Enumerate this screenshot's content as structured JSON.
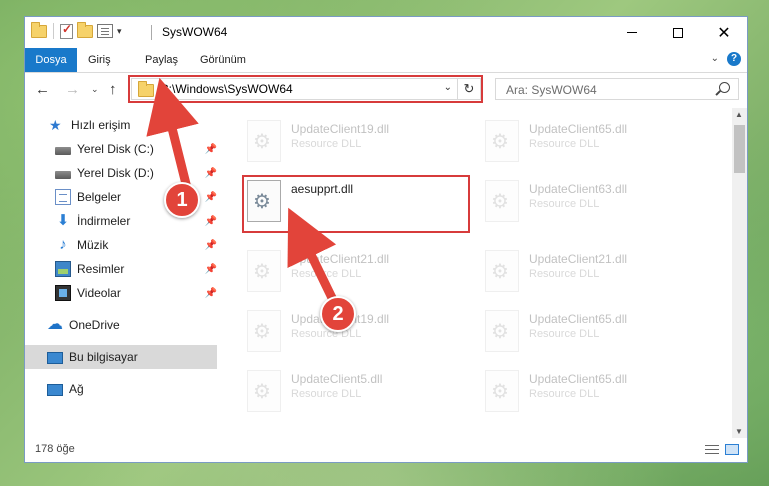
{
  "window": {
    "title": "SysWOW64",
    "controls": {
      "minimize_icon": "minimize-icon",
      "maximize_icon": "maximize-icon",
      "close_icon": "close-icon"
    }
  },
  "ribbon": {
    "tabs": [
      "Dosya",
      "Giriş",
      "Paylaş",
      "Görünüm"
    ],
    "accent": "#1979ca"
  },
  "address": {
    "path": "C:\\Windows\\SysWOW64"
  },
  "search": {
    "placeholder": "Ara: SysWOW64"
  },
  "sidebar": {
    "quick_access": "Hızlı erişim",
    "items": [
      {
        "label": "Yerel Disk (C:)",
        "pinned": true
      },
      {
        "label": "Yerel Disk (D:)",
        "pinned": true
      },
      {
        "label": "Belgeler",
        "pinned": true
      },
      {
        "label": "İndirmeler",
        "pinned": true
      },
      {
        "label": "Müzik",
        "pinned": true
      },
      {
        "label": "Resimler",
        "pinned": true
      },
      {
        "label": "Videolar",
        "pinned": true
      }
    ],
    "onedrive": "OneDrive",
    "this_pc": "Bu bilgisayar",
    "network": "Ağ"
  },
  "files": [
    {
      "name": "UpdateClient19.dll",
      "type": "Resource DLL"
    },
    {
      "name": "UpdateClient65.dll",
      "type": "Resource DLL"
    },
    {
      "name": "aesupprt.dll",
      "type": ""
    },
    {
      "name": "UpdateClient63.dll",
      "type": "Resource DLL"
    },
    {
      "name": "UpdateClient21.dll",
      "type": "Resource DLL"
    },
    {
      "name": "UpdateClient21.dll",
      "type": "Resource DLL"
    },
    {
      "name": "UpdateClient19.dll",
      "type": "Resource DLL"
    },
    {
      "name": "UpdateClient65.dll",
      "type": "Resource DLL"
    },
    {
      "name": "UpdateClient5.dll",
      "type": "Resource DLL"
    },
    {
      "name": "UpdateClient65.dll",
      "type": "Resource DLL"
    }
  ],
  "status": {
    "count": "178 öğe"
  },
  "annotations": {
    "callout1": "1",
    "callout2": "2",
    "highlight_color": "#d73b3b"
  }
}
